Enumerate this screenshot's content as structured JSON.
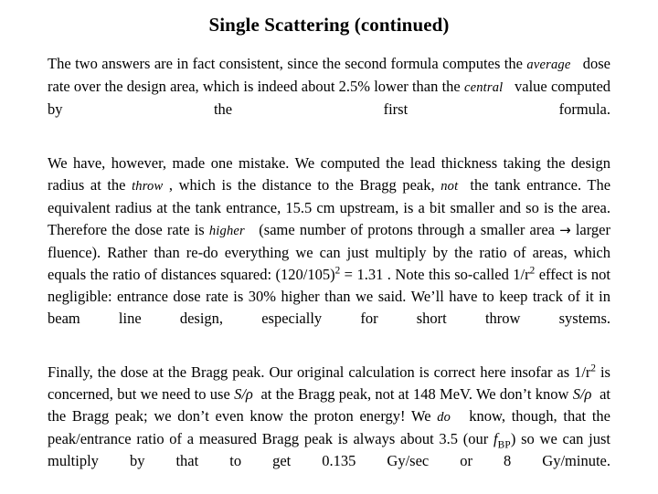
{
  "slide": {
    "title": "Single Scattering (continued)",
    "background_color": "#ffffff",
    "text_color": "#000000"
  },
  "paragraphs": [
    {
      "id": "p1",
      "runs": [
        {
          "text": "The two answers are in fact consistent, since the second formula computes the ",
          "style": "normal"
        },
        {
          "text": "average",
          "style": "italic"
        },
        {
          "text": "  dose rate over the design area, which is indeed about 2.5% lower than the ",
          "style": "normal"
        },
        {
          "text": "central",
          "style": "italic"
        },
        {
          "text": "  value computed by the first formula.",
          "style": "normal"
        }
      ],
      "plain": "The two answers are in fact consistent, since the second formula computes the average dose rate over the design area, which is indeed about 2.5% lower than the central value computed by the first formula."
    },
    {
      "id": "p2",
      "runs": [
        {
          "text": "We have, however, made one mistake. We computed the lead thickness taking the design radius at the ",
          "style": "normal"
        },
        {
          "text": "throw",
          "style": "italic"
        },
        {
          "text": " , which is the distance to the Bragg peak, ",
          "style": "normal"
        },
        {
          "text": "not",
          "style": "italic"
        },
        {
          "text": " the tank entrance. The equivalent radius at the tank entrance, 15.5 cm upstream, is a bit smaller and so is the area. Therefore the dose rate is ",
          "style": "normal"
        },
        {
          "text": "higher",
          "style": "italic"
        },
        {
          "text": "  (same number of protons through a smaller area ",
          "style": "normal"
        },
        {
          "text": "→",
          "style": "arrow"
        },
        {
          "text": " larger fluence). Rather than re-do everything we can just multiply by the ratio of areas, which equals the ratio of distances squared: (120/105)",
          "style": "normal"
        },
        {
          "text": "2",
          "style": "superscript"
        },
        {
          "text": " = 1.31 . Note this so-called 1/r",
          "style": "normal"
        },
        {
          "text": "2",
          "style": "superscript"
        },
        {
          "text": " effect is not negligible: entrance dose rate is 30% higher than we said. We’ll have to keep track of it in beam line design, especially for short throw systems.",
          "style": "normal"
        }
      ],
      "plain": "We have, however, made one mistake. We computed the lead thickness taking the design radius at the throw , which is the distance to the Bragg peak, not the tank entrance. The equivalent radius at the tank entrance, 15.5 cm upstream, is a bit smaller and so is the area. Therefore the dose rate is higher (same number of protons through a smaller area → larger fluence). Rather than re-do everything we can just multiply by the ratio of areas, which equals the ratio of distances squared: (120/105)2 = 1.31 . Note this so-called 1/r2 effect is not negligible: entrance dose rate is 30% higher than we said. We’ll have to keep track of it in beam line design, especially for short throw systems."
    },
    {
      "id": "p3",
      "runs": [
        {
          "text": "Finally, the dose at the Bragg peak. Our original calculation is correct here insofar as 1/r",
          "style": "normal"
        },
        {
          "text": "2",
          "style": "superscript"
        },
        {
          "text": " is concerned, but we need to use ",
          "style": "normal"
        },
        {
          "text": "S/ρ",
          "style": "italic"
        },
        {
          "text": " at the Bragg peak, not at 148 MeV. We don’t know ",
          "style": "normal"
        },
        {
          "text": "S/ρ",
          "style": "italic"
        },
        {
          "text": " at the Bragg peak; we don’t even know the proton energy! We ",
          "style": "normal"
        },
        {
          "text": "do",
          "style": "italic"
        },
        {
          "text": "  know, though, that the peak/entrance ratio of a measured Bragg peak is always about 3.5 (our ",
          "style": "normal"
        },
        {
          "text": "f",
          "style": "italic"
        },
        {
          "text": "BP",
          "style": "subscript-smallcaps"
        },
        {
          "text": ") so we can just multiply by that to get 0.135 Gy/sec or 8 Gy/minute.",
          "style": "normal"
        }
      ],
      "plain": "Finally, the dose at the Bragg peak. Our original calculation is correct here insofar as 1/r2 is concerned, but we need to use S/ρ at the Bragg peak, not at 148 MeV. We don’t know S/ρ at the Bragg peak; we don’t even know the proton energy! We do know, though, that the peak/entrance ratio of a measured Bragg peak is always about 3.5 (our fBP) so we can just multiply by that to get 0.135 Gy/sec or 8 Gy/minute."
    }
  ],
  "values": {
    "percent_lower": "2.5%",
    "upstream_distance": "15.5 cm",
    "ratio_numerator": "120",
    "ratio_denominator": "105",
    "area_ratio": "1.31",
    "percent_higher": "30%",
    "reference_energy": "148 MeV",
    "peak_entrance_ratio": "3.5",
    "dose_rate_gy_per_sec": "0.135 Gy/sec",
    "dose_rate_gy_per_minute": "8 Gy/minute"
  }
}
